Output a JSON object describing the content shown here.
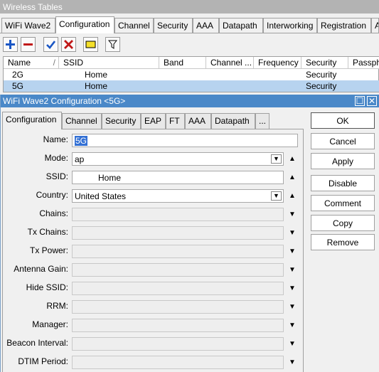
{
  "tables": {
    "title": "Wireless Tables",
    "tabs": [
      "WiFi Wave2",
      "Configuration",
      "Channel",
      "Security",
      "AAA",
      "Datapath",
      "Interworking",
      "Registration",
      "A"
    ],
    "columns": [
      "Name",
      "SSID",
      "Band",
      "Channel ...",
      "Frequency",
      "Security",
      "Passphr"
    ],
    "rows": [
      {
        "name": "2G",
        "ssid": "Home",
        "band": "",
        "channel": "",
        "frequency": "",
        "security": "Security",
        "passphrase": ""
      },
      {
        "name": "5G",
        "ssid": "Home",
        "band": "",
        "channel": "",
        "frequency": "",
        "security": "Security",
        "passphrase": ""
      }
    ],
    "toolbar": {
      "add_icon": "plus-icon",
      "remove_icon": "minus-icon",
      "enable_icon": "check-icon",
      "disable_icon": "x-icon",
      "comment_icon": "note-icon",
      "filter_icon": "filter-icon"
    }
  },
  "dialog": {
    "title": "WiFi Wave2 Configuration <5G>",
    "controls": {
      "maximize": "☐",
      "close": "✕"
    },
    "tabs": [
      "Configuration",
      "Channel",
      "Security",
      "EAP",
      "FT",
      "AAA",
      "Datapath",
      "..."
    ],
    "fields": [
      {
        "label": "Name:",
        "value": "5G"
      },
      {
        "label": "Mode:",
        "value": "ap"
      },
      {
        "label": "SSID:",
        "value": "Home"
      },
      {
        "label": "Country:",
        "value": "United States"
      },
      {
        "label": "Chains:",
        "value": ""
      },
      {
        "label": "Tx Chains:",
        "value": ""
      },
      {
        "label": "Tx Power:",
        "value": ""
      },
      {
        "label": "Antenna Gain:",
        "value": ""
      },
      {
        "label": "Hide SSID:",
        "value": ""
      },
      {
        "label": "RRM:",
        "value": ""
      },
      {
        "label": "Manager:",
        "value": ""
      },
      {
        "label": "Beacon Interval:",
        "value": ""
      },
      {
        "label": "DTIM Period:",
        "value": ""
      }
    ],
    "buttons": [
      "OK",
      "Cancel",
      "Apply",
      "Disable",
      "Comment",
      "Copy",
      "Remove"
    ]
  },
  "colors": {
    "add": "#1a56c4",
    "remove": "#c01818",
    "enable": "#1a56c4",
    "disable": "#c01818",
    "title_bar": "#4a88c8",
    "selected_row": "#b7d3ef"
  }
}
